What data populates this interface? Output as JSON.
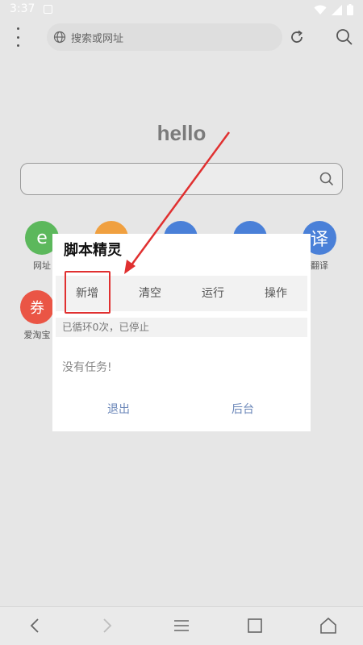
{
  "status_bar": {
    "time": "3:37"
  },
  "browser": {
    "url_placeholder": "搜索或网址",
    "home_title": "hello"
  },
  "shortcuts": [
    {
      "label": "网址",
      "glyph": "e",
      "color": "#5cb85c"
    },
    {
      "label": "",
      "glyph": "",
      "color": "#f0a040"
    },
    {
      "label": "",
      "glyph": "",
      "color": "#4a80d8"
    },
    {
      "label": "",
      "glyph": "",
      "color": "#4a80d8"
    },
    {
      "label": "翻译",
      "glyph": "译",
      "color": "#4a80d8"
    },
    {
      "label": "爱淘宝",
      "glyph": "券",
      "color": "#ea5545"
    }
  ],
  "dialog": {
    "title": "脚本精灵",
    "tabs": [
      "新增",
      "清空",
      "运行",
      "操作"
    ],
    "status": "已循环0次，已停止",
    "empty": "没有任务!",
    "exit": "退出",
    "background": "后台"
  }
}
